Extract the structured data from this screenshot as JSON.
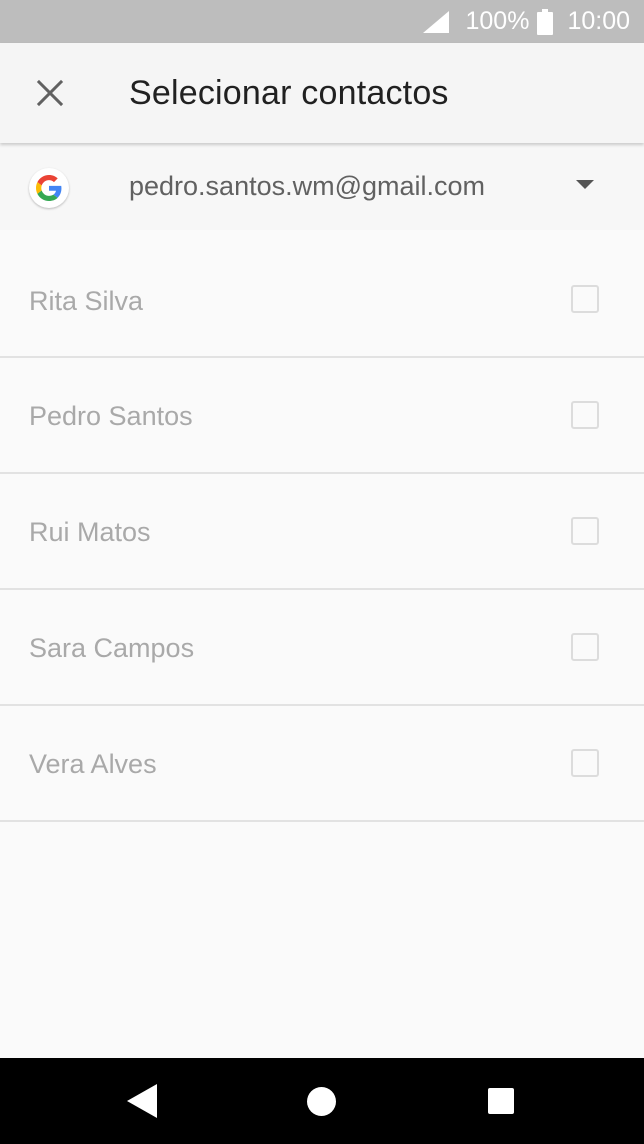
{
  "status_bar": {
    "battery_percent": "100%",
    "time": "10:00",
    "icons": [
      "signal-icon",
      "battery-icon"
    ]
  },
  "app_bar": {
    "close_icon": "close-icon",
    "title": "Selecionar contactos"
  },
  "account": {
    "icon": "google-icon",
    "email": "pedro.santos.wm@gmail.com",
    "dropdown_icon": "dropdown-arrow-icon"
  },
  "contacts": [
    {
      "name": "Rita Silva",
      "checked": false
    },
    {
      "name": "Pedro Santos",
      "checked": false
    },
    {
      "name": "Rui Matos",
      "checked": false
    },
    {
      "name": "Sara Campos",
      "checked": false
    },
    {
      "name": "Vera Alves",
      "checked": false
    }
  ],
  "nav_bar": {
    "icons": [
      "back-icon",
      "home-icon",
      "recents-icon"
    ]
  },
  "colors": {
    "status_bar": "#bdbdbd",
    "app_bar": "#f5f5f5",
    "background": "#fafafa",
    "google_blue": "#4285F4",
    "google_red": "#EA4335",
    "google_yellow": "#FBBC05",
    "google_green": "#34A853"
  }
}
